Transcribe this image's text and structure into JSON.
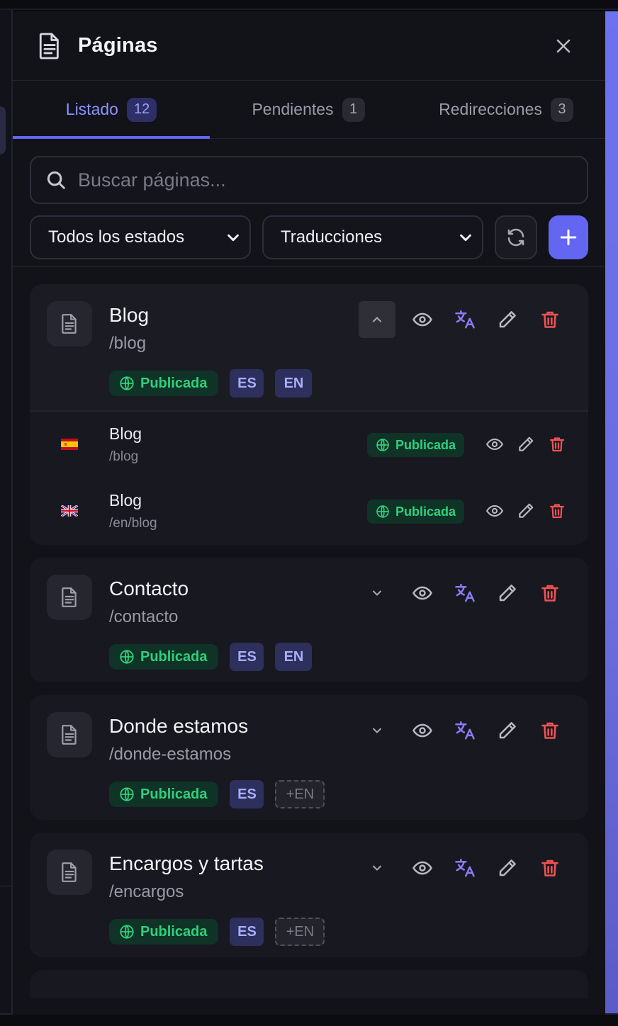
{
  "header": {
    "title": "Páginas"
  },
  "tabs": [
    {
      "label": "Listado",
      "count": "12"
    },
    {
      "label": "Pendientes",
      "count": "1"
    },
    {
      "label": "Redirecciones",
      "count": "3"
    }
  ],
  "search": {
    "placeholder": "Buscar páginas..."
  },
  "filters": {
    "status_select": "Todos los estados",
    "translation_select": "Traducciones"
  },
  "colors": {
    "accent": "#6366f1",
    "published_green": "#2fd07c",
    "delete_red": "#f05252",
    "translate_purple": "#8b7cf6"
  },
  "pages": [
    {
      "name": "Blog",
      "slug": "/blog",
      "status": "Publicada",
      "langs": {
        "es": "ES",
        "en": "EN"
      },
      "translations": [
        {
          "flag": "spain-flag-icon",
          "name": "Blog",
          "slug": "/blog",
          "status": "Publicada"
        },
        {
          "flag": "uk-flag-icon",
          "name": "Blog",
          "slug": "/en/blog",
          "status": "Publicada"
        }
      ]
    },
    {
      "name": "Contacto",
      "slug": "/contacto",
      "status": "Publicada",
      "langs": {
        "es": "ES",
        "en": "EN"
      }
    },
    {
      "name": "Donde estamos",
      "slug": "/donde-estamos",
      "status": "Publicada",
      "langs": {
        "es": "ES",
        "en_missing": "+EN"
      }
    },
    {
      "name": "Encargos y tartas",
      "slug": "/encargos",
      "status": "Publicada",
      "langs": {
        "es": "ES",
        "en_missing": "+EN"
      }
    }
  ]
}
